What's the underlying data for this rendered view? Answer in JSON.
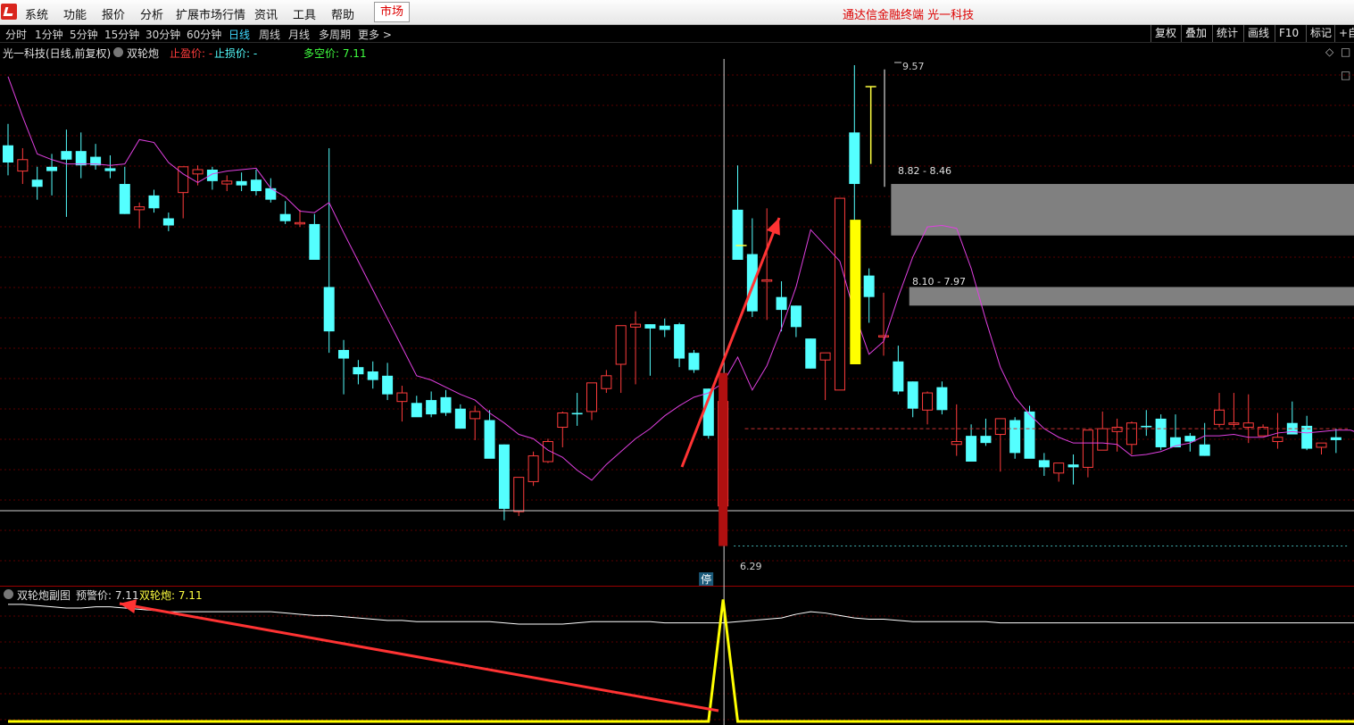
{
  "menubar": {
    "items": [
      "系统",
      "功能",
      "报价",
      "分析",
      "扩展市场行情",
      "资讯",
      "工具",
      "帮助"
    ],
    "market_tab": "市场",
    "app_title": "通达信金融终端 光一科技"
  },
  "periodbar": {
    "items": [
      "分时",
      "1分钟",
      "5分钟",
      "15分钟",
      "30分钟",
      "60分钟",
      "日线",
      "周线",
      "月线",
      "多周期",
      "更多 >"
    ],
    "active": "日线",
    "tools": [
      "复权",
      "叠加",
      "统计",
      "画线",
      "F10",
      "标记",
      "+自"
    ]
  },
  "main_panel": {
    "stock_label": "光一科技(日线,前复权)",
    "indicator_name": "双轮炮",
    "take_profit_label": "止盈价: -",
    "stop_loss_label": "止损价: -",
    "bull_bear_label": "多空价: 7.11",
    "price_high_label": "9.57",
    "price_low_label": "6.29",
    "zone_upper_label": "8.82 - 8.46",
    "zone_lower_label": "8.10 - 7.97",
    "limit_marker": "停"
  },
  "sub_panel": {
    "name": "双轮炮副图",
    "alert_label": "预警价: 7.11",
    "value_label": "双轮炮: 7.11"
  },
  "colors": {
    "up": "#ff3c3c",
    "down": "#54ffff",
    "ma_line": "#e040e0",
    "sub_white": "#ffffff",
    "sub_yellow": "#ffff00",
    "zone_gray": "#808080",
    "arrow_red": "#ff3333"
  },
  "chart_data": {
    "type": "candlestick",
    "price_ylim": [
      6.15,
      9.65
    ],
    "sub_ylim": [
      0,
      1
    ],
    "series": [
      {
        "name": "candles",
        "ohlc": [
          [
            9.09,
            9.24,
            8.88,
            8.97
          ],
          [
            8.91,
            9.07,
            8.82,
            8.99
          ],
          [
            8.85,
            8.94,
            8.71,
            8.8
          ],
          [
            8.94,
            9.03,
            8.74,
            8.91
          ],
          [
            9.05,
            9.2,
            8.59,
            8.99
          ],
          [
            9.05,
            9.18,
            8.86,
            8.95
          ],
          [
            9.01,
            9.1,
            8.92,
            8.95
          ],
          [
            8.93,
            9.02,
            8.86,
            8.91
          ],
          [
            8.82,
            8.94,
            8.61,
            8.61
          ],
          [
            8.64,
            8.69,
            8.51,
            8.66
          ],
          [
            8.74,
            8.78,
            8.62,
            8.65
          ],
          [
            8.58,
            8.62,
            8.49,
            8.53
          ],
          [
            8.76,
            8.93,
            8.58,
            8.94
          ],
          [
            8.89,
            8.95,
            8.81,
            8.92
          ],
          [
            8.92,
            8.94,
            8.78,
            8.84
          ],
          [
            8.82,
            8.88,
            8.77,
            8.84
          ],
          [
            8.84,
            8.9,
            8.77,
            8.81
          ],
          [
            8.85,
            8.92,
            8.74,
            8.77
          ],
          [
            8.79,
            8.86,
            8.69,
            8.71
          ],
          [
            8.61,
            8.7,
            8.54,
            8.56
          ],
          [
            8.55,
            8.64,
            8.52,
            8.55
          ],
          [
            8.54,
            8.61,
            8.31,
            8.29
          ],
          [
            8.1,
            9.07,
            7.64,
            7.79
          ],
          [
            7.66,
            7.73,
            7.35,
            7.6
          ],
          [
            7.54,
            7.59,
            7.42,
            7.49
          ],
          [
            7.51,
            7.58,
            7.39,
            7.45
          ],
          [
            7.48,
            7.57,
            7.31,
            7.35
          ],
          [
            7.3,
            7.41,
            7.16,
            7.36
          ],
          [
            7.29,
            7.34,
            7.2,
            7.19
          ],
          [
            7.31,
            7.37,
            7.19,
            7.21
          ],
          [
            7.33,
            7.38,
            7.2,
            7.22
          ],
          [
            7.25,
            7.28,
            7.11,
            7.11
          ],
          [
            7.18,
            7.27,
            7.03,
            7.23
          ],
          [
            7.17,
            7.24,
            6.91,
            6.9
          ],
          [
            7.0,
            7.0,
            6.47,
            6.55
          ],
          [
            6.53,
            6.77,
            6.5,
            6.77
          ],
          [
            6.74,
            6.95,
            6.71,
            6.92
          ],
          [
            6.88,
            7.04,
            6.87,
            7.02
          ],
          [
            7.12,
            7.23,
            6.98,
            7.22
          ],
          [
            7.22,
            7.36,
            7.13,
            7.21
          ],
          [
            7.23,
            7.43,
            7.17,
            7.43
          ],
          [
            7.39,
            7.52,
            7.36,
            7.48
          ],
          [
            7.56,
            7.81,
            7.36,
            7.83
          ],
          [
            7.82,
            7.93,
            7.42,
            7.84
          ],
          [
            7.84,
            7.84,
            7.48,
            7.81
          ],
          [
            7.83,
            7.88,
            7.75,
            7.8
          ],
          [
            7.84,
            7.85,
            7.54,
            7.6
          ],
          [
            7.64,
            7.66,
            7.5,
            7.52
          ],
          [
            7.39,
            7.39,
            7.04,
            7.06
          ],
          [
            6.57,
            7.3,
            6.29,
            7.3
          ],
          [
            8.64,
            8.95,
            8.29,
            8.29
          ],
          [
            8.33,
            8.58,
            7.89,
            7.93
          ],
          [
            8.14,
            8.65,
            7.87,
            8.15
          ],
          [
            8.03,
            8.14,
            7.79,
            7.94
          ],
          [
            7.97,
            7.97,
            7.75,
            7.82
          ],
          [
            7.74,
            7.74,
            7.53,
            7.53
          ],
          [
            7.59,
            7.59,
            7.31,
            7.64
          ],
          [
            7.38,
            8.65,
            7.4,
            8.72
          ],
          [
            9.18,
            9.65,
            8.48,
            8.82
          ],
          [
            8.18,
            8.23,
            7.85,
            8.03
          ],
          [
            7.76,
            8.06,
            7.62,
            7.76
          ],
          [
            7.58,
            7.69,
            7.35,
            7.37
          ],
          [
            7.44,
            7.44,
            7.19,
            7.25
          ],
          [
            7.24,
            7.37,
            7.14,
            7.36
          ],
          [
            7.4,
            7.44,
            7.21,
            7.24
          ],
          [
            7.0,
            7.28,
            6.92,
            7.02
          ],
          [
            7.06,
            7.14,
            6.9,
            6.88
          ],
          [
            7.06,
            7.18,
            6.99,
            7.01
          ],
          [
            7.07,
            7.11,
            6.81,
            7.18
          ],
          [
            7.17,
            7.19,
            6.9,
            6.94
          ],
          [
            7.23,
            7.27,
            6.99,
            6.9
          ],
          [
            6.89,
            6.94,
            6.78,
            6.84
          ],
          [
            6.8,
            6.87,
            6.74,
            6.87
          ],
          [
            6.86,
            6.93,
            6.72,
            6.84
          ],
          [
            6.84,
            7.06,
            6.77,
            7.1
          ],
          [
            6.96,
            7.23,
            6.96,
            7.11
          ],
          [
            7.09,
            7.18,
            6.95,
            7.12
          ],
          [
            7.0,
            7.16,
            6.93,
            7.15
          ],
          [
            7.13,
            7.24,
            7.06,
            7.12
          ],
          [
            7.18,
            7.21,
            6.96,
            6.98
          ],
          [
            7.05,
            7.21,
            6.98,
            6.98
          ],
          [
            7.06,
            7.08,
            6.95,
            7.02
          ],
          [
            7.0,
            7.15,
            6.92,
            6.92
          ],
          [
            7.14,
            7.36,
            7.12,
            7.24
          ],
          [
            7.14,
            7.36,
            7.12,
            7.15
          ],
          [
            7.12,
            7.35,
            7.01,
            7.15
          ],
          [
            7.06,
            7.14,
            7.06,
            7.12
          ],
          [
            7.02,
            7.22,
            6.97,
            7.05
          ],
          [
            7.15,
            7.3,
            7.08,
            7.07
          ],
          [
            7.13,
            7.2,
            6.96,
            6.97
          ],
          [
            6.98,
            7.01,
            6.93,
            7.01
          ],
          [
            7.05,
            7.11,
            6.94,
            7.03
          ]
        ]
      },
      {
        "name": "ma",
        "values": [
          9.57,
          9.29,
          9.03,
          8.99,
          8.96,
          8.96,
          8.96,
          8.95,
          8.96,
          9.13,
          9.11,
          8.97,
          8.89,
          8.83,
          8.89,
          8.91,
          8.92,
          8.93,
          8.79,
          8.73,
          8.63,
          8.62,
          8.69,
          8.48,
          8.28,
          8.08,
          7.88,
          7.68,
          7.48,
          7.45,
          7.4,
          7.35,
          7.31,
          7.22,
          7.15,
          7.07,
          7.04,
          6.96,
          6.91,
          6.82,
          6.75,
          6.86,
          6.95,
          7.04,
          7.11,
          7.2,
          7.27,
          7.33,
          7.36,
          7.43,
          7.61,
          7.38,
          7.55,
          7.81,
          8.1,
          8.5,
          8.39,
          8.28,
          7.92,
          7.63,
          7.72,
          8.03,
          8.31,
          8.52,
          8.53,
          8.51,
          8.23,
          7.87,
          7.54,
          7.33,
          7.21,
          7.11,
          7.05,
          7.01,
          7.01,
          7.01,
          7.0,
          6.92,
          6.93,
          6.95,
          6.99,
          7.01,
          7.06,
          7.06,
          7.07,
          7.05,
          7.05,
          7.08,
          7.09,
          7.08,
          7.09,
          7.1,
          7.1,
          7.06,
          7.09
        ]
      },
      {
        "name": "双轮炮副图",
        "values": [
          0.95,
          0.95,
          0.94,
          0.93,
          0.92,
          0.92,
          0.93,
          0.93,
          0.92,
          0.91,
          0.9,
          0.89,
          0.89,
          0.89,
          0.89,
          0.89,
          0.89,
          0.89,
          0.89,
          0.88,
          0.87,
          0.86,
          0.86,
          0.85,
          0.84,
          0.83,
          0.82,
          0.82,
          0.81,
          0.81,
          0.81,
          0.81,
          0.81,
          0.81,
          0.8,
          0.79,
          0.79,
          0.79,
          0.79,
          0.8,
          0.81,
          0.81,
          0.81,
          0.81,
          0.81,
          0.8,
          0.8,
          0.8,
          0.8,
          0.8,
          0.81,
          0.82,
          0.83,
          0.84,
          0.87,
          0.89,
          0.88,
          0.86,
          0.84,
          0.83,
          0.83,
          0.82,
          0.81,
          0.81,
          0.81,
          0.81,
          0.81,
          0.81,
          0.8,
          0.8,
          0.8,
          0.8,
          0.8,
          0.8,
          0.8,
          0.8,
          0.8,
          0.8,
          0.8,
          0.8,
          0.8,
          0.8,
          0.8,
          0.8,
          0.8,
          0.8,
          0.8,
          0.8,
          0.8,
          0.8,
          0.8,
          0.8,
          0.8,
          0.8,
          0.8
        ]
      },
      {
        "name": "双轮炮",
        "values": [
          0,
          0,
          0,
          0,
          0,
          0,
          0,
          0,
          0,
          0,
          0,
          0,
          0,
          0,
          0,
          0,
          0,
          0,
          0,
          0,
          0,
          0,
          0,
          0,
          0,
          0,
          0,
          0,
          0,
          0,
          0,
          0,
          0,
          0,
          0,
          0,
          0,
          0,
          0,
          0,
          0,
          0,
          0,
          0,
          0,
          0,
          0,
          0,
          0,
          0.99,
          0,
          0,
          0,
          0,
          0,
          0,
          0,
          0,
          0,
          0,
          0,
          0,
          0,
          0,
          0,
          0,
          0,
          0,
          0,
          0,
          0,
          0,
          0,
          0,
          0,
          0,
          0,
          0,
          0,
          0,
          0,
          0,
          0,
          0,
          0,
          0,
          0,
          0,
          0,
          0,
          0,
          0,
          0,
          0,
          0
        ]
      }
    ],
    "zones": [
      [
        8.46,
        8.82
      ],
      [
        7.97,
        8.1
      ]
    ],
    "bull_bear_price": 7.11,
    "limit_price": 6.29,
    "high_price": 9.57,
    "grid": true
  }
}
